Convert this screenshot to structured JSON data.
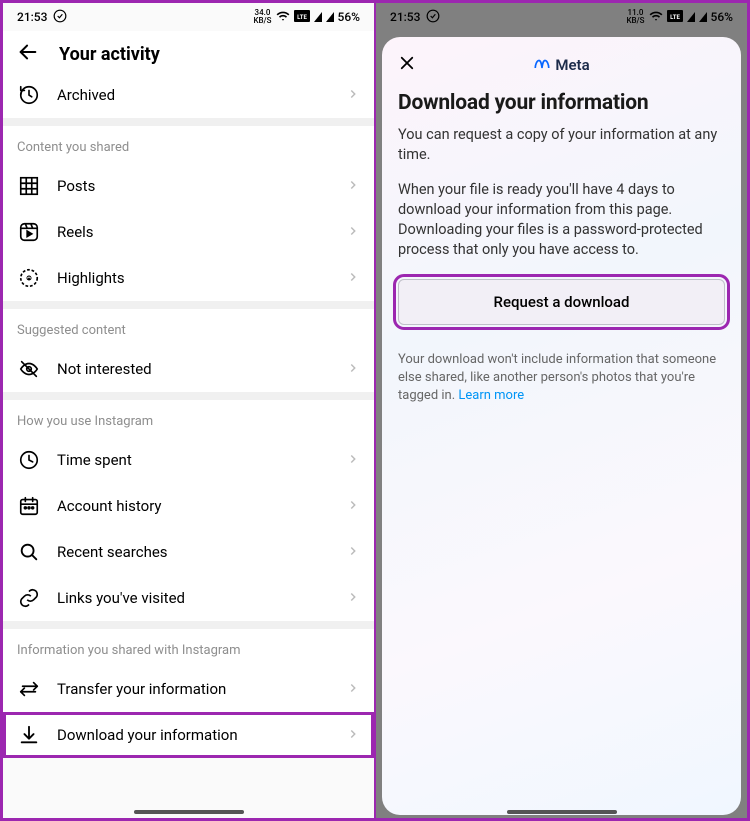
{
  "status": {
    "time": "21:53",
    "speed_value": "34.0",
    "speed_unit": "KB/S",
    "speed_value_r": "11.0",
    "battery": "56%"
  },
  "left": {
    "title": "Your activity",
    "top_item": "Archived",
    "sections": [
      {
        "label": "Content you shared",
        "items": [
          {
            "icon": "grid",
            "label": "Posts"
          },
          {
            "icon": "reels",
            "label": "Reels"
          },
          {
            "icon": "highlights",
            "label": "Highlights"
          }
        ]
      },
      {
        "label": "Suggested content",
        "items": [
          {
            "icon": "eye-off",
            "label": "Not interested"
          }
        ]
      },
      {
        "label": "How you use Instagram",
        "items": [
          {
            "icon": "clock",
            "label": "Time spent"
          },
          {
            "icon": "calendar",
            "label": "Account history"
          },
          {
            "icon": "search",
            "label": "Recent searches"
          },
          {
            "icon": "link",
            "label": "Links you've visited"
          }
        ]
      },
      {
        "label": "Information you shared with Instagram",
        "items": [
          {
            "icon": "transfer",
            "label": "Transfer your information"
          },
          {
            "icon": "download",
            "label": "Download your information",
            "highlight": true
          }
        ]
      }
    ]
  },
  "right": {
    "brand": "Meta",
    "heading": "Download your information",
    "para1": "You can request a copy of your information at any time.",
    "para2": "When your file is ready you'll have 4 days to download your information from this page. Downloading your files is a password-protected process that only you have access to.",
    "button": "Request a download",
    "note_prefix": "Your download won't include information that someone else shared, like another person's photos that you're tagged in. ",
    "learn_more": "Learn more"
  }
}
